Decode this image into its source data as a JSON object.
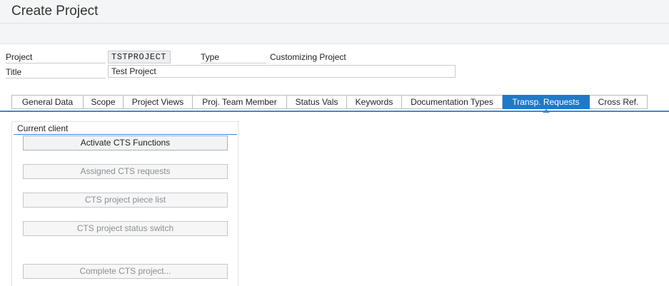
{
  "window": {
    "title": "Create Project"
  },
  "header_fields": {
    "project_label": "Project",
    "project_value": "TSTPROJECT",
    "type_label": "Type",
    "type_value": "Customizing Project",
    "title_label": "Title",
    "title_value": "Test Project"
  },
  "tabs": [
    {
      "label": "General Data",
      "active": false
    },
    {
      "label": "Scope",
      "active": false
    },
    {
      "label": "Project Views",
      "active": false
    },
    {
      "label": "Proj. Team Member",
      "active": false
    },
    {
      "label": "Status Vals",
      "active": false
    },
    {
      "label": "Keywords",
      "active": false
    },
    {
      "label": "Documentation Types",
      "active": false
    },
    {
      "label": "Transp. Requests",
      "active": true
    },
    {
      "label": "Cross Ref.",
      "active": false
    }
  ],
  "group": {
    "title": "Current client",
    "buttons": [
      {
        "label": "Activate CTS Functions",
        "enabled": true
      },
      {
        "label": "Assigned CTS requests",
        "enabled": false
      },
      {
        "label": "CTS project piece list",
        "enabled": false
      },
      {
        "label": "CTS project status switch",
        "enabled": false
      },
      {
        "label": "Complete CTS project...",
        "enabled": false
      }
    ]
  },
  "colors": {
    "accent": "#1f79c8",
    "title_bar_bg": "#f4f5f6",
    "disabled_text": "#8b8f94"
  }
}
